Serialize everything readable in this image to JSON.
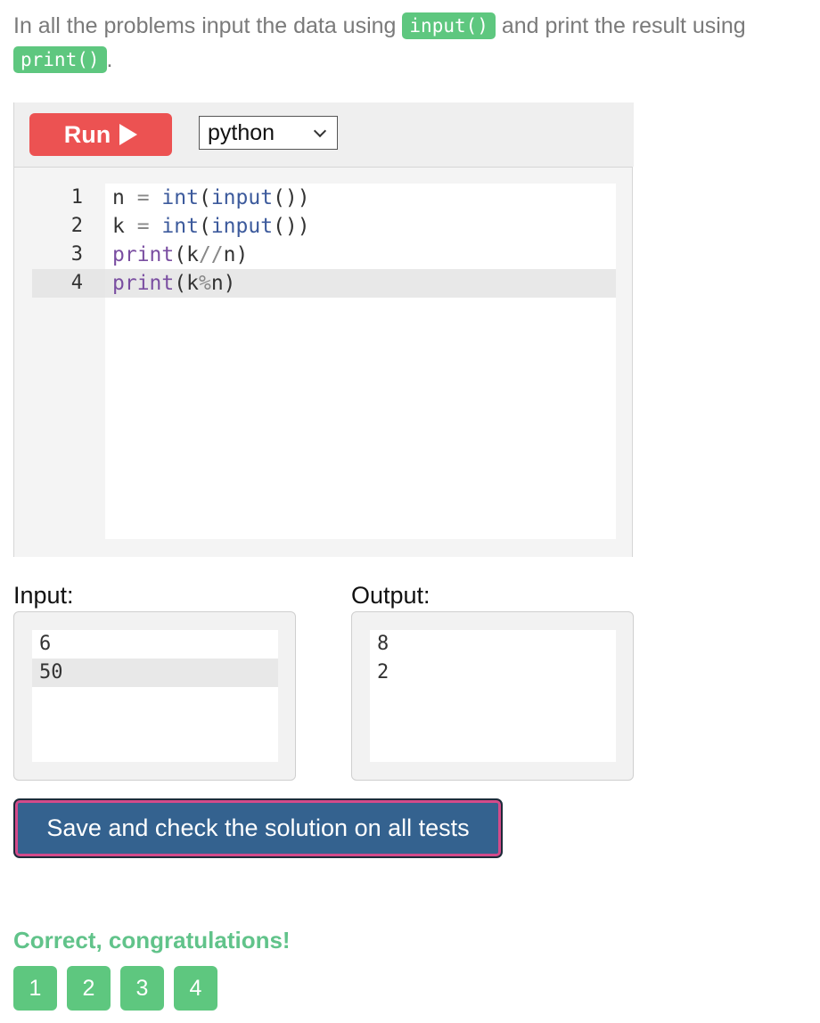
{
  "intro": {
    "text_before": "In all the problems input the data using",
    "chip_input": "input()",
    "text_middle": "and print the result using",
    "chip_print": "print()",
    "text_after": "."
  },
  "toolbar": {
    "run_label": "Run",
    "language": "python"
  },
  "editor": {
    "line_numbers": [
      "1",
      "2",
      "3",
      "4"
    ],
    "lines": {
      "l1": {
        "var": "n",
        "eq": " = ",
        "fn1": "int",
        "p1": "(",
        "fn2": "input",
        "p2": "())"
      },
      "l2": {
        "var": "k",
        "eq": " = ",
        "fn1": "int",
        "p1": "(",
        "fn2": "input",
        "p2": "())"
      },
      "l3": {
        "fn": "print",
        "a": "(k",
        "op": "//",
        "b": "n)"
      },
      "l4": {
        "fn": "print",
        "a": "(k",
        "op": "%",
        "b": "n)"
      }
    }
  },
  "io": {
    "input_label": "Input:",
    "output_label": "Output:",
    "input_lines": [
      "6",
      "50"
    ],
    "output_lines": [
      "8",
      "2"
    ]
  },
  "check_button_label": "Save and check the solution on all tests",
  "result_text": "Correct, congratulations!",
  "tests": [
    "1",
    "2",
    "3",
    "4"
  ],
  "colors": {
    "accent_green": "#5ec77f",
    "run_red": "#ec5252",
    "check_blue": "#34628f"
  }
}
